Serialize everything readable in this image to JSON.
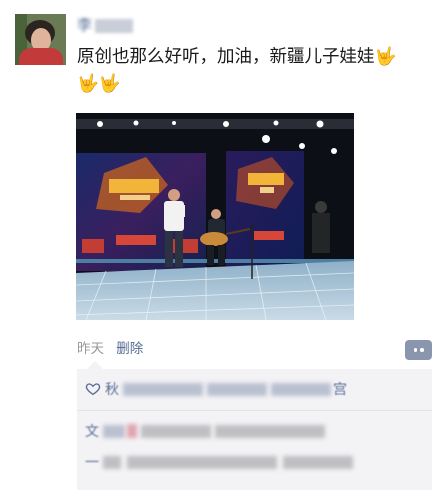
{
  "post": {
    "author_visible": "李",
    "caption": "原创也那么好听，加油，新疆儿子娃娃🤟🤟🤟",
    "timestamp": "昨天",
    "delete_label": "删除"
  },
  "interactions": {
    "likes_visible": "秋",
    "likes_tail_visible": "宫",
    "comment1_visible": "文",
    "comment2_visible": "一"
  }
}
